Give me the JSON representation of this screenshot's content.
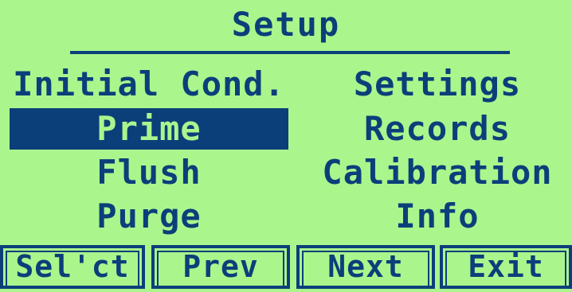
{
  "screen": {
    "title": "Setup"
  },
  "menu": {
    "left": [
      {
        "label": "Initial Cond.",
        "selected": false
      },
      {
        "label": "Prime",
        "selected": true
      },
      {
        "label": "Flush",
        "selected": false
      },
      {
        "label": "Purge",
        "selected": false
      }
    ],
    "right": [
      {
        "label": "Settings",
        "selected": false
      },
      {
        "label": "Records",
        "selected": false
      },
      {
        "label": "Calibration",
        "selected": false
      },
      {
        "label": "Info",
        "selected": false
      }
    ]
  },
  "softkeys": {
    "select": "Sel'ct",
    "prev": "Prev",
    "next": "Next",
    "exit": "Exit"
  },
  "colors": {
    "background": "#abf58d",
    "foreground": "#0b3f7a"
  }
}
